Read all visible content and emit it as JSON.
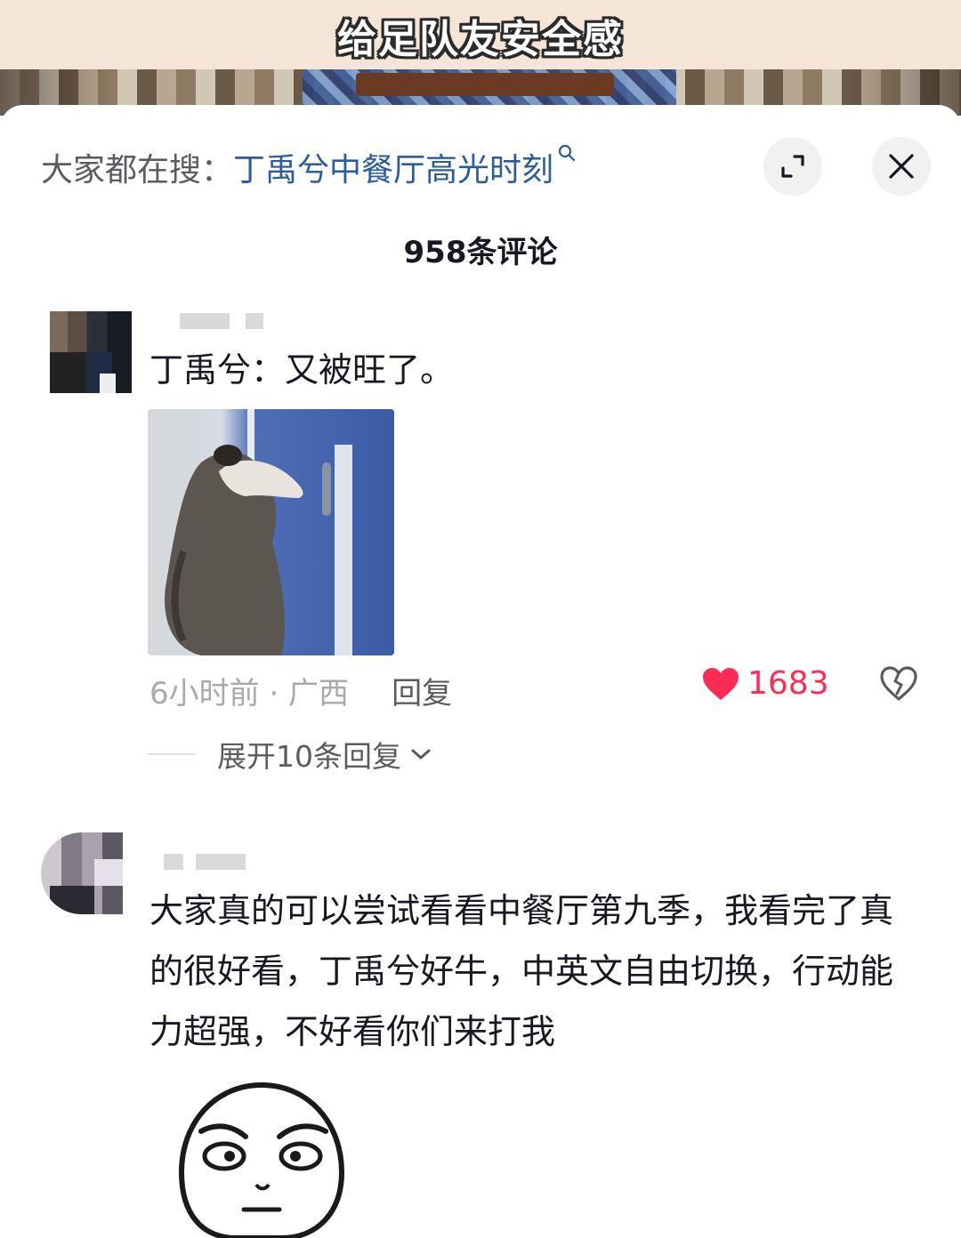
{
  "video": {
    "caption": "给足队友安全感"
  },
  "header": {
    "search_prefix": "大家都在搜：",
    "search_term": "丁禹兮中餐厅高光时刻",
    "comment_count": "958条评论"
  },
  "comments": [
    {
      "text": "丁禹兮：又被旺了。",
      "time_location": "6小时前 · 广西",
      "reply_label": "回复",
      "likes": "1683",
      "expand_label": "展开10条回复"
    },
    {
      "text": "大家真的可以尝试看看中餐厅第九季，我看完了真的很好看，丁禹兮好牛，中英文自由切换，行动能力超强，不好看你们来打我"
    }
  ],
  "icons": {
    "search": "search-icon",
    "expand": "expand-icon",
    "close": "close-icon",
    "like": "heart-icon",
    "dislike": "broken-heart-icon",
    "chevron": "chevron-down-icon"
  },
  "colors": {
    "like": "#fe2c55",
    "search_term": "#2c5d9a"
  }
}
